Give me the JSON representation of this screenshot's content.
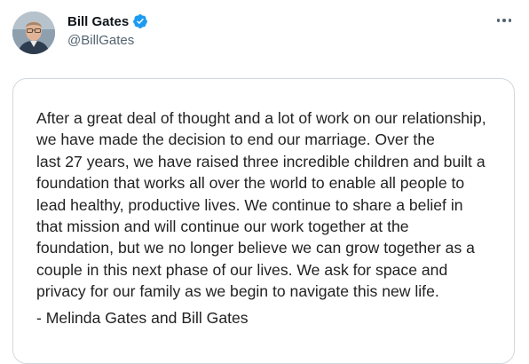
{
  "author": {
    "display_name": "Bill Gates",
    "handle": "@BillGates",
    "verified": true,
    "avatar_icon": "profile-photo"
  },
  "menu": {
    "icon": "more-horizontal-icon"
  },
  "image_card": {
    "statement": "After a great deal of thought and a lot of work on our relationship,\nwe have made the decision to end our marriage. Over the\nlast 27 years, we have raised three incredible children and built a\nfoundation that works all over the world to enable all people to\nlead healthy, productive lives. We continue to share a belief in\nthat mission and will continue our work together at the\nfoundation, but we no longer believe we can grow together as a\ncouple in this next phase of our lives. We ask for space and\nprivacy for our family as we begin to navigate this new life.",
    "signature": "- Melinda Gates and Bill Gates"
  },
  "colors": {
    "verified_badge": "#1d9bf0",
    "handle_text": "#536471",
    "card_border": "#cfd9de"
  }
}
